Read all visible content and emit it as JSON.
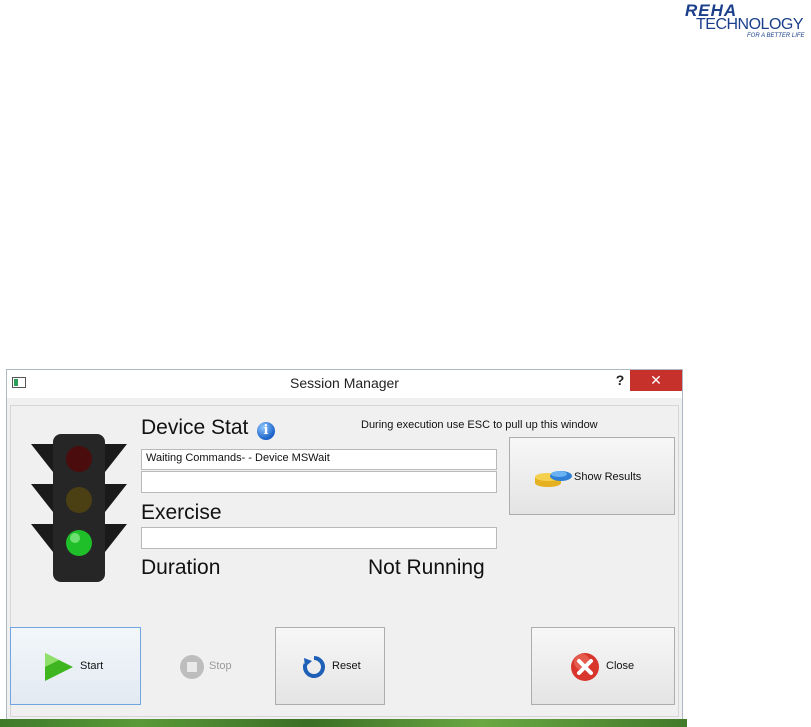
{
  "logo": {
    "line1": "REHA",
    "line2": "TECHNOLOGY",
    "tagline": "FOR A BETTER LIFE"
  },
  "window": {
    "title": "Session Manager",
    "help_label": "?",
    "close_label": "✕"
  },
  "session": {
    "device_state_label": "Device Stat",
    "hint": "During execution use ESC to pull up this window",
    "device_status_line1": "Waiting Commands- - Device MSWait",
    "device_status_line2": "",
    "exercise_label": "Exercise",
    "exercise_value": "",
    "duration_label": "Duration",
    "running_status": "Not Running",
    "traffic_light_active": "green"
  },
  "buttons": {
    "show_results": "Show Results",
    "start": "Start",
    "stop": "Stop",
    "reset": "Reset",
    "close": "Close"
  },
  "colors": {
    "close_red": "#c7312b",
    "brand": "#1b3f8b",
    "light_green": "#21c32b"
  }
}
